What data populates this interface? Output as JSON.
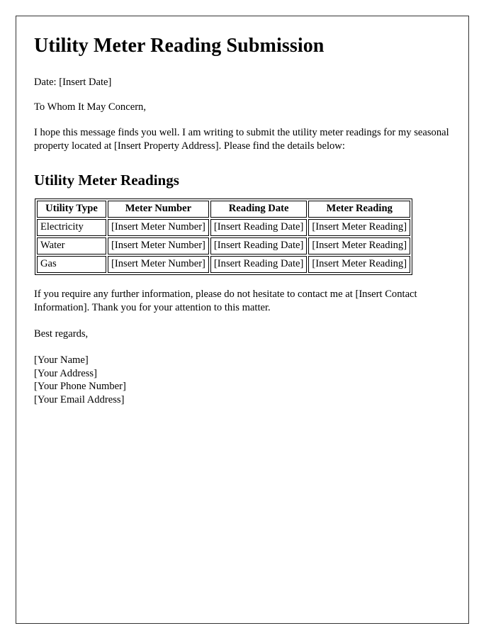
{
  "document": {
    "title": "Utility Meter Reading Submission",
    "date_line": "Date: [Insert Date]",
    "salutation": "To Whom It May Concern,",
    "intro_paragraph": "I hope this message finds you well. I am writing to submit the utility meter readings for my seasonal property located at [Insert Property Address]. Please find the details below:",
    "section_heading": "Utility Meter Readings",
    "closing_paragraph": "If you require any further information, please do not hesitate to contact me at [Insert Contact Information]. Thank you for your attention to this matter.",
    "signoff": "Best regards,",
    "signature_block": [
      "[Your Name]",
      "[Your Address]",
      "[Your Phone Number]",
      "[Your Email Address]"
    ]
  },
  "table": {
    "headers": [
      "Utility Type",
      "Meter Number",
      "Reading Date",
      "Meter Reading"
    ],
    "rows": [
      {
        "utility_type": "Electricity",
        "meter_number": "[Insert Meter Number]",
        "reading_date": "[Insert Reading Date]",
        "meter_reading": "[Insert Meter Reading]"
      },
      {
        "utility_type": "Water",
        "meter_number": "[Insert Meter Number]",
        "reading_date": "[Insert Reading Date]",
        "meter_reading": "[Insert Meter Reading]"
      },
      {
        "utility_type": "Gas",
        "meter_number": "[Insert Meter Number]",
        "reading_date": "[Insert Reading Date]",
        "meter_reading": "[Insert Meter Reading]"
      }
    ]
  },
  "colors": {
    "page_border": "#333333",
    "text": "#000000",
    "table_border": "#000000",
    "background": "#ffffff"
  }
}
